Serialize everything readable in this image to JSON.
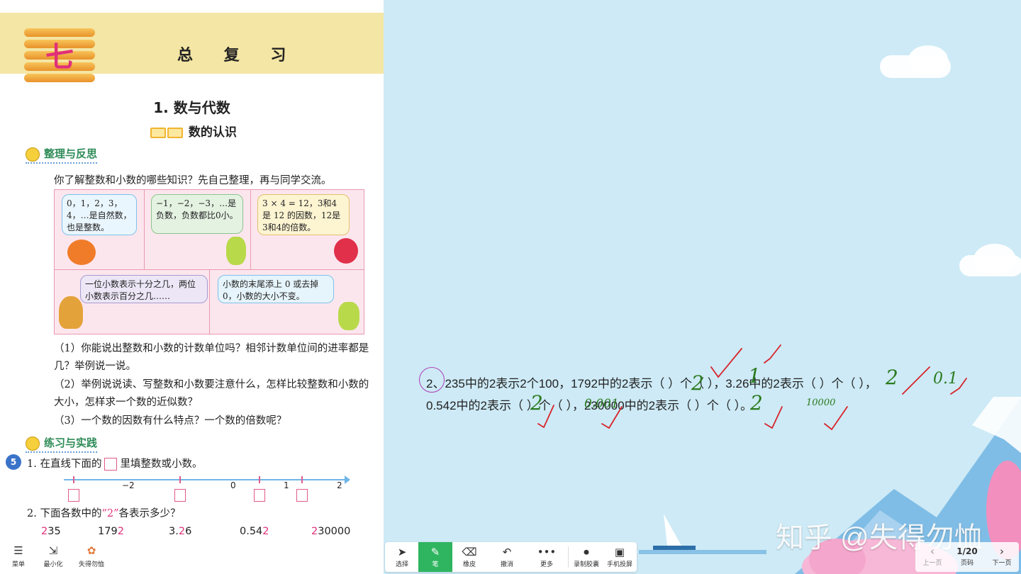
{
  "textbook": {
    "chapter_num": "七",
    "chapter_title": "总 复 习",
    "section_title": "1. 数与代数",
    "subsection_title": "数的认识",
    "tag_reflect": "整理与反思",
    "intro": "你了解整数和小数的哪些知识？先自己整理，再与同学交流。",
    "bubbles": [
      "0，1，2，3，4，…是自然数，也是整数。",
      "−1，−2，−3，…是负数，负数都比0小。",
      "3 × 4 = 12，3和4是 12 的因数，12是3和4的倍数。",
      "一位小数表示十分之几，两位小数表示百分之几……",
      "小数的末尾添上 0 或去掉0，小数的大小不变。"
    ],
    "questions": [
      "（1）你能说出整数和小数的计数单位吗？相邻计数单位间的进率都是几？举例说一说。",
      "（2）举例说说读、写整数和小数要注意什么，怎样比较整数和小数的大小，怎样求一个数的近似数？",
      "（3）一个数的因数有什么特点？一个数的倍数呢？"
    ],
    "tag_practice": "练习与实践",
    "exercise_badge": "5",
    "ex1_prefix": "1. 在直线下面的",
    "ex1_suffix": "里填整数或小数。",
    "numberline_labels": [
      "−2",
      "0",
      "1",
      "2"
    ],
    "ex2_prefix": "2. 下面各数中的",
    "ex2_highlight": "“2”",
    "ex2_suffix": "各表示多少？",
    "numbers": [
      {
        "pre": "",
        "two": "2",
        "post": "35"
      },
      {
        "pre": "179",
        "two": "2",
        "post": ""
      },
      {
        "pre": "3.",
        "two": "2",
        "post": "6"
      },
      {
        "pre": "0.54",
        "two": "2",
        "post": ""
      },
      {
        "pre": "",
        "two": "2",
        "post": "30000"
      }
    ]
  },
  "left_toolbar": {
    "menu": "菜单",
    "minimize": "最小化",
    "app": "失得勿恤"
  },
  "whiteboard": {
    "line1_a": "2、235中的2表示2个100，1792中的2表示（      ）个（      ），3.26中的2表示（      ）个（        ），",
    "line2_a": "0.542中的2表示（      ）个（          ），230000中的2表示（      ）个（            ）。",
    "handwritten": [
      "2",
      "1",
      "2",
      "0.1",
      "2",
      "0.001",
      "2",
      "10000"
    ],
    "watermark": "知乎 @失得勿恤"
  },
  "toolbar": {
    "select": "选择",
    "pen": "笔",
    "eraser": "橡皮",
    "undo": "撤消",
    "more": "更多",
    "record": "录制胶囊",
    "cast": "手机投屏"
  },
  "pager": {
    "prev": "上一页",
    "page_label": "页码",
    "page": "1/20",
    "next": "下一页"
  },
  "colors": {
    "accent": "#2fb560",
    "handwriting": "#2b7a1f",
    "check": "#d8232a",
    "circle": "#b03fb8"
  }
}
